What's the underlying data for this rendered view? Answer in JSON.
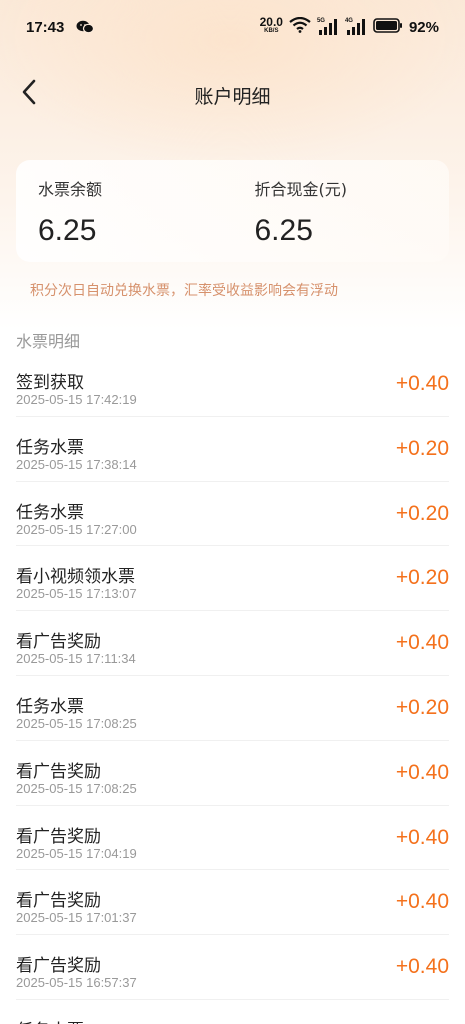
{
  "status_bar": {
    "time": "17:43",
    "net_speed_value": "20.0",
    "net_speed_unit": "KB/S",
    "signal1_tag": "5G",
    "signal2_tag": "4G",
    "battery": "92%"
  },
  "header": {
    "title": "账户明细",
    "back_icon": "chevron-left-icon"
  },
  "balance": {
    "ticket_label": "水票余额",
    "ticket_value": "6.25",
    "cash_label": "折合现金(元)",
    "cash_value": "6.25"
  },
  "note": "积分次日自动兑换水票，汇率受收益影响会有浮动",
  "section_title": "水票明细",
  "records": [
    {
      "name": "签到获取",
      "time": "2025-05-15 17:42:19",
      "amount": "+0.40"
    },
    {
      "name": "任务水票",
      "time": "2025-05-15 17:38:14",
      "amount": "+0.20"
    },
    {
      "name": "任务水票",
      "time": "2025-05-15 17:27:00",
      "amount": "+0.20"
    },
    {
      "name": "看小视频领水票",
      "time": "2025-05-15 17:13:07",
      "amount": "+0.20"
    },
    {
      "name": "看广告奖励",
      "time": "2025-05-15 17:11:34",
      "amount": "+0.40"
    },
    {
      "name": "任务水票",
      "time": "2025-05-15 17:08:25",
      "amount": "+0.20"
    },
    {
      "name": "看广告奖励",
      "time": "2025-05-15 17:08:25",
      "amount": "+0.40"
    },
    {
      "name": "看广告奖励",
      "time": "2025-05-15 17:04:19",
      "amount": "+0.40"
    },
    {
      "name": "看广告奖励",
      "time": "2025-05-15 17:01:37",
      "amount": "+0.40"
    },
    {
      "name": "看广告奖励",
      "time": "2025-05-15 16:57:37",
      "amount": "+0.40"
    },
    {
      "name": "任务水票",
      "time": "",
      "amount": ""
    }
  ],
  "colors": {
    "accent": "#f4711c",
    "note": "#d6916c",
    "muted": "#999999"
  }
}
